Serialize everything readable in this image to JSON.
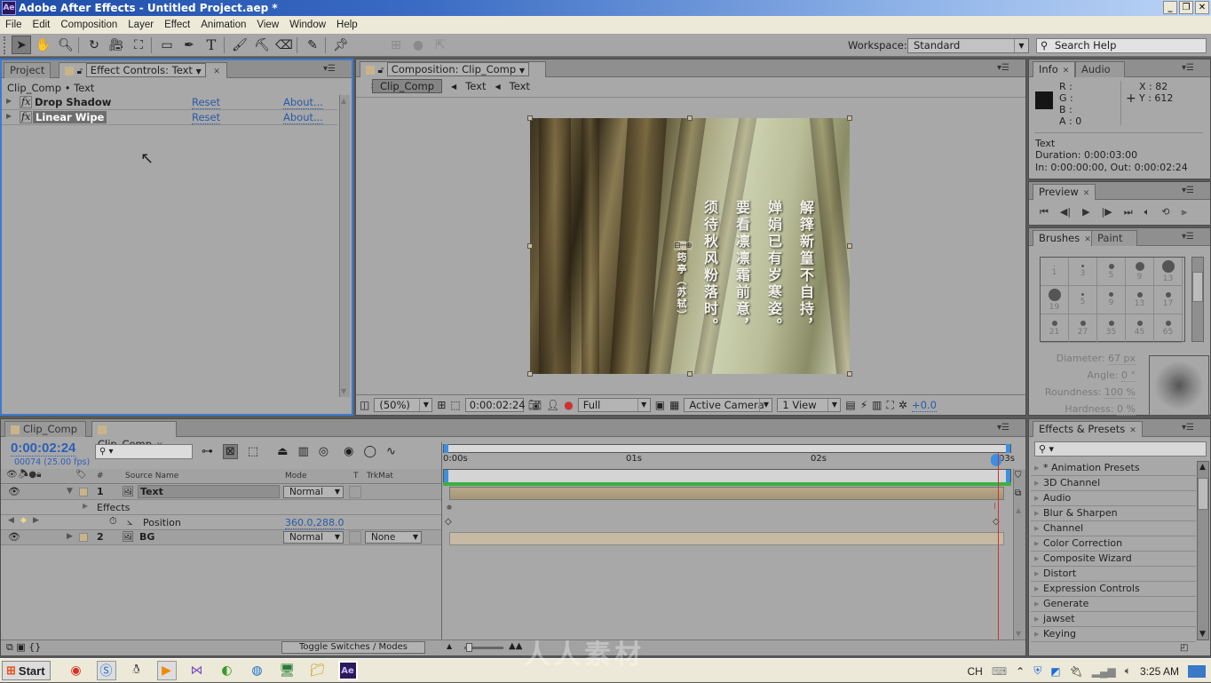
{
  "window": {
    "title": "Adobe After Effects - Untitled Project.aep *",
    "app_icon": "Ae",
    "controls": [
      "_",
      "restore",
      "X"
    ]
  },
  "menu": [
    "File",
    "Edit",
    "Composition",
    "Layer",
    "Effect",
    "Animation",
    "View",
    "Window",
    "Help"
  ],
  "toolbar": {
    "tools": [
      "selection-tool",
      "hand-tool",
      "zoom-tool",
      "rotation-tool",
      "camera-tool",
      "pan-behind-tool",
      "rectangle-tool",
      "pen-tool",
      "type-tool",
      "brush-tool",
      "clone-stamp-tool",
      "eraser-tool",
      "roto-brush-tool",
      "puppet-pin-tool"
    ],
    "workspace_label": "Workspace:",
    "workspace_value": "Standard",
    "search_placeholder": "Search Help"
  },
  "project_panel": {
    "tabs": {
      "project": "Project",
      "effect_controls": "Effect Controls: Text"
    },
    "header": "Clip_Comp • Text",
    "effects": [
      {
        "name": "Drop Shadow",
        "reset": "Reset",
        "about": "About..."
      },
      {
        "name": "Linear Wipe",
        "reset": "Reset",
        "about": "About...",
        "selected": true
      }
    ]
  },
  "composition_panel": {
    "tab": "Composition: Clip_Comp",
    "breadcrumb": [
      "Clip_Comp",
      "Text",
      "Text"
    ],
    "poem_columns": [
      "解箨新篁不自持，",
      "婵娟已有岁寒姿。",
      "要看凛凛霜前意，",
      "须待秋风粉落时。",
      "霜筠亭（苏轼）"
    ],
    "footer": {
      "zoom": "(50%)",
      "timecode": "0:00:02:24",
      "resolution": "Full",
      "camera": "Active Camera",
      "views": "1 View",
      "exposure": "+0.0"
    }
  },
  "info_panel": {
    "tabs": {
      "info": "Info",
      "audio": "Audio"
    },
    "r": "R :",
    "g": "G :",
    "b": "B :",
    "a": "A :  0",
    "x": "X : 82",
    "y": "Y : 612",
    "layer": "Text",
    "duration": "Duration: 0:00:03:00",
    "inout": "In: 0:00:00:00, Out: 0:00:02:24"
  },
  "preview_panel": {
    "tab": "Preview"
  },
  "brushes_panel": {
    "tabs": {
      "brushes": "Brushes",
      "paint": "Paint"
    },
    "sizes": [
      "1",
      "3",
      "5",
      "9",
      "13",
      "19",
      "5",
      "9",
      "13",
      "17",
      "21",
      "27",
      "35",
      "45",
      "65"
    ],
    "diameter_label": "Diameter:",
    "diameter": "67 px",
    "angle_label": "Angle:",
    "angle": "0 °",
    "roundness_label": "Roundness:",
    "roundness": "100 %",
    "hardness_label": "Hardness:",
    "hardness": "0 %"
  },
  "effects_presets": {
    "tab": "Effects & Presets",
    "search_value": "",
    "items": [
      "* Animation Presets",
      "3D Channel",
      "Audio",
      "Blur & Sharpen",
      "Channel",
      "Color Correction",
      "Composite Wizard",
      "Distort",
      "Expression Controls",
      "Generate",
      "jawset",
      "Keying"
    ]
  },
  "timeline": {
    "tabs": [
      "Clip_Comp",
      "Clip_Comp"
    ],
    "current_time": "0:00:02:24",
    "frame_info": "00074 (25.00 fps)",
    "columns": {
      "num": "#",
      "source": "Source Name",
      "mode": "Mode",
      "t": "T",
      "trkmat": "TrkMat"
    },
    "layers": [
      {
        "num": "1",
        "name": "Text",
        "mode": "Normal",
        "trkmat": ""
      },
      {
        "num": "2",
        "name": "BG",
        "mode": "Normal",
        "trkmat": "None"
      }
    ],
    "effects_label": "Effects",
    "position_label": "Position",
    "position_value": "360.0,288.0",
    "ruler": [
      "0:00s",
      "01s",
      "02s",
      "03s"
    ],
    "toggle_label": "Toggle Switches / Modes"
  },
  "taskbar": {
    "start": "Start",
    "lang": "CH",
    "time": "3:25 AM"
  },
  "watermark": "人人素材"
}
